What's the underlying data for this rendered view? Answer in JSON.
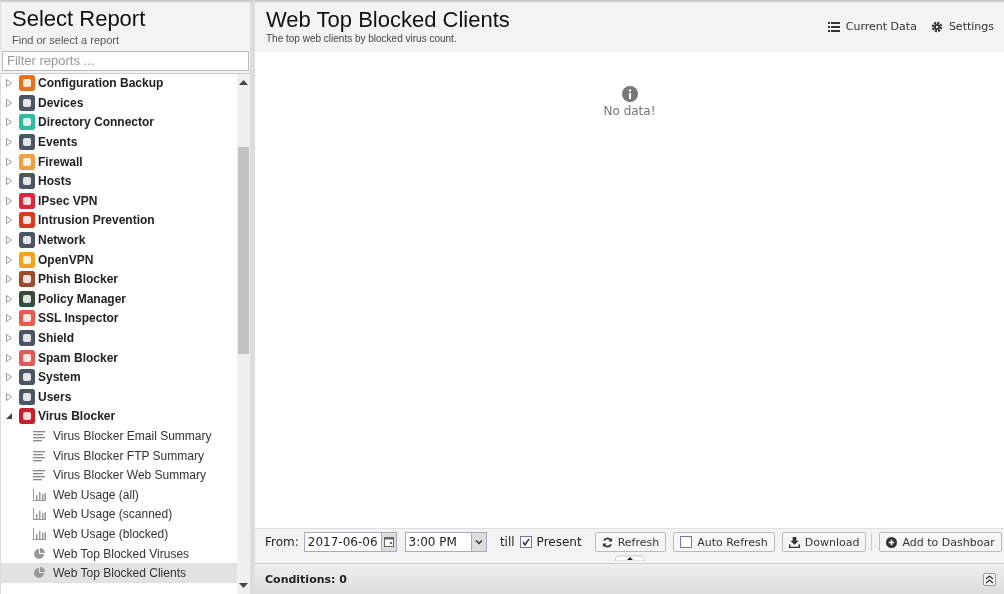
{
  "sidebar": {
    "title": "Select Report",
    "subtitle": "Find or select a report",
    "filter": {
      "placeholder": "Filter reports ..."
    },
    "tree": [
      {
        "label": "Configuration Backup",
        "color": "#e8731c",
        "expanded": false
      },
      {
        "label": "Devices",
        "color": "#4b5563",
        "expanded": false
      },
      {
        "label": "Directory Connector",
        "color": "#2bbf9f",
        "expanded": false
      },
      {
        "label": "Events",
        "color": "#4b5563",
        "expanded": false
      },
      {
        "label": "Firewall",
        "color": "#f0a040",
        "expanded": false
      },
      {
        "label": "Hosts",
        "color": "#4b5563",
        "expanded": false
      },
      {
        "label": "IPsec VPN",
        "color": "#d8283c",
        "expanded": false
      },
      {
        "label": "Intrusion Prevention",
        "color": "#d83a22",
        "expanded": false
      },
      {
        "label": "Network",
        "color": "#4b5563",
        "expanded": false
      },
      {
        "label": "OpenVPN",
        "color": "#f4a21c",
        "expanded": false
      },
      {
        "label": "Phish Blocker",
        "color": "#a0482a",
        "expanded": false
      },
      {
        "label": "Policy Manager",
        "color": "#3a4a3a",
        "expanded": false
      },
      {
        "label": "SSL Inspector",
        "color": "#e85a4a",
        "expanded": false
      },
      {
        "label": "Shield",
        "color": "#4b5563",
        "expanded": false
      },
      {
        "label": "Spam Blocker",
        "color": "#e05a5a",
        "expanded": false
      },
      {
        "label": "System",
        "color": "#4b5563",
        "expanded": false
      },
      {
        "label": "Users",
        "color": "#4b5563",
        "expanded": false
      },
      {
        "label": "Virus Blocker",
        "color": "#c8202a",
        "expanded": true,
        "children": [
          {
            "label": "Virus Blocker Email Summary",
            "kind": "text",
            "selected": false
          },
          {
            "label": "Virus Blocker FTP Summary",
            "kind": "text",
            "selected": false
          },
          {
            "label": "Virus Blocker Web Summary",
            "kind": "text",
            "selected": false
          },
          {
            "label": "Web Usage (all)",
            "kind": "bar",
            "selected": false
          },
          {
            "label": "Web Usage (scanned)",
            "kind": "bar",
            "selected": false
          },
          {
            "label": "Web Usage (blocked)",
            "kind": "bar",
            "selected": false
          },
          {
            "label": "Web Top Blocked Viruses",
            "kind": "pie",
            "selected": false
          },
          {
            "label": "Web Top Blocked Clients",
            "kind": "pie",
            "selected": true
          }
        ]
      }
    ]
  },
  "report": {
    "title": "Web Top Blocked Clients",
    "subtitle": "The top web clients by blocked virus count.",
    "actions": [
      {
        "label": "Current Data",
        "kind": "list"
      },
      {
        "label": "Settings",
        "kind": "gear"
      }
    ],
    "message": "No data!"
  },
  "toolbar": {
    "from_label": "From:",
    "date": "2017-06-06",
    "time": "3:00 PM",
    "till_label": "till",
    "present": {
      "label": "Present",
      "checked": true
    },
    "buttons": [
      {
        "label": "Refresh",
        "kind": "refresh"
      },
      {
        "label": "Auto Refresh",
        "kind": "checkbox",
        "checked": false
      },
      {
        "label": "Download",
        "kind": "download"
      },
      {
        "label": "Add to Dashboar",
        "kind": "add"
      }
    ]
  },
  "conditions": {
    "label": "Conditions: 0"
  }
}
